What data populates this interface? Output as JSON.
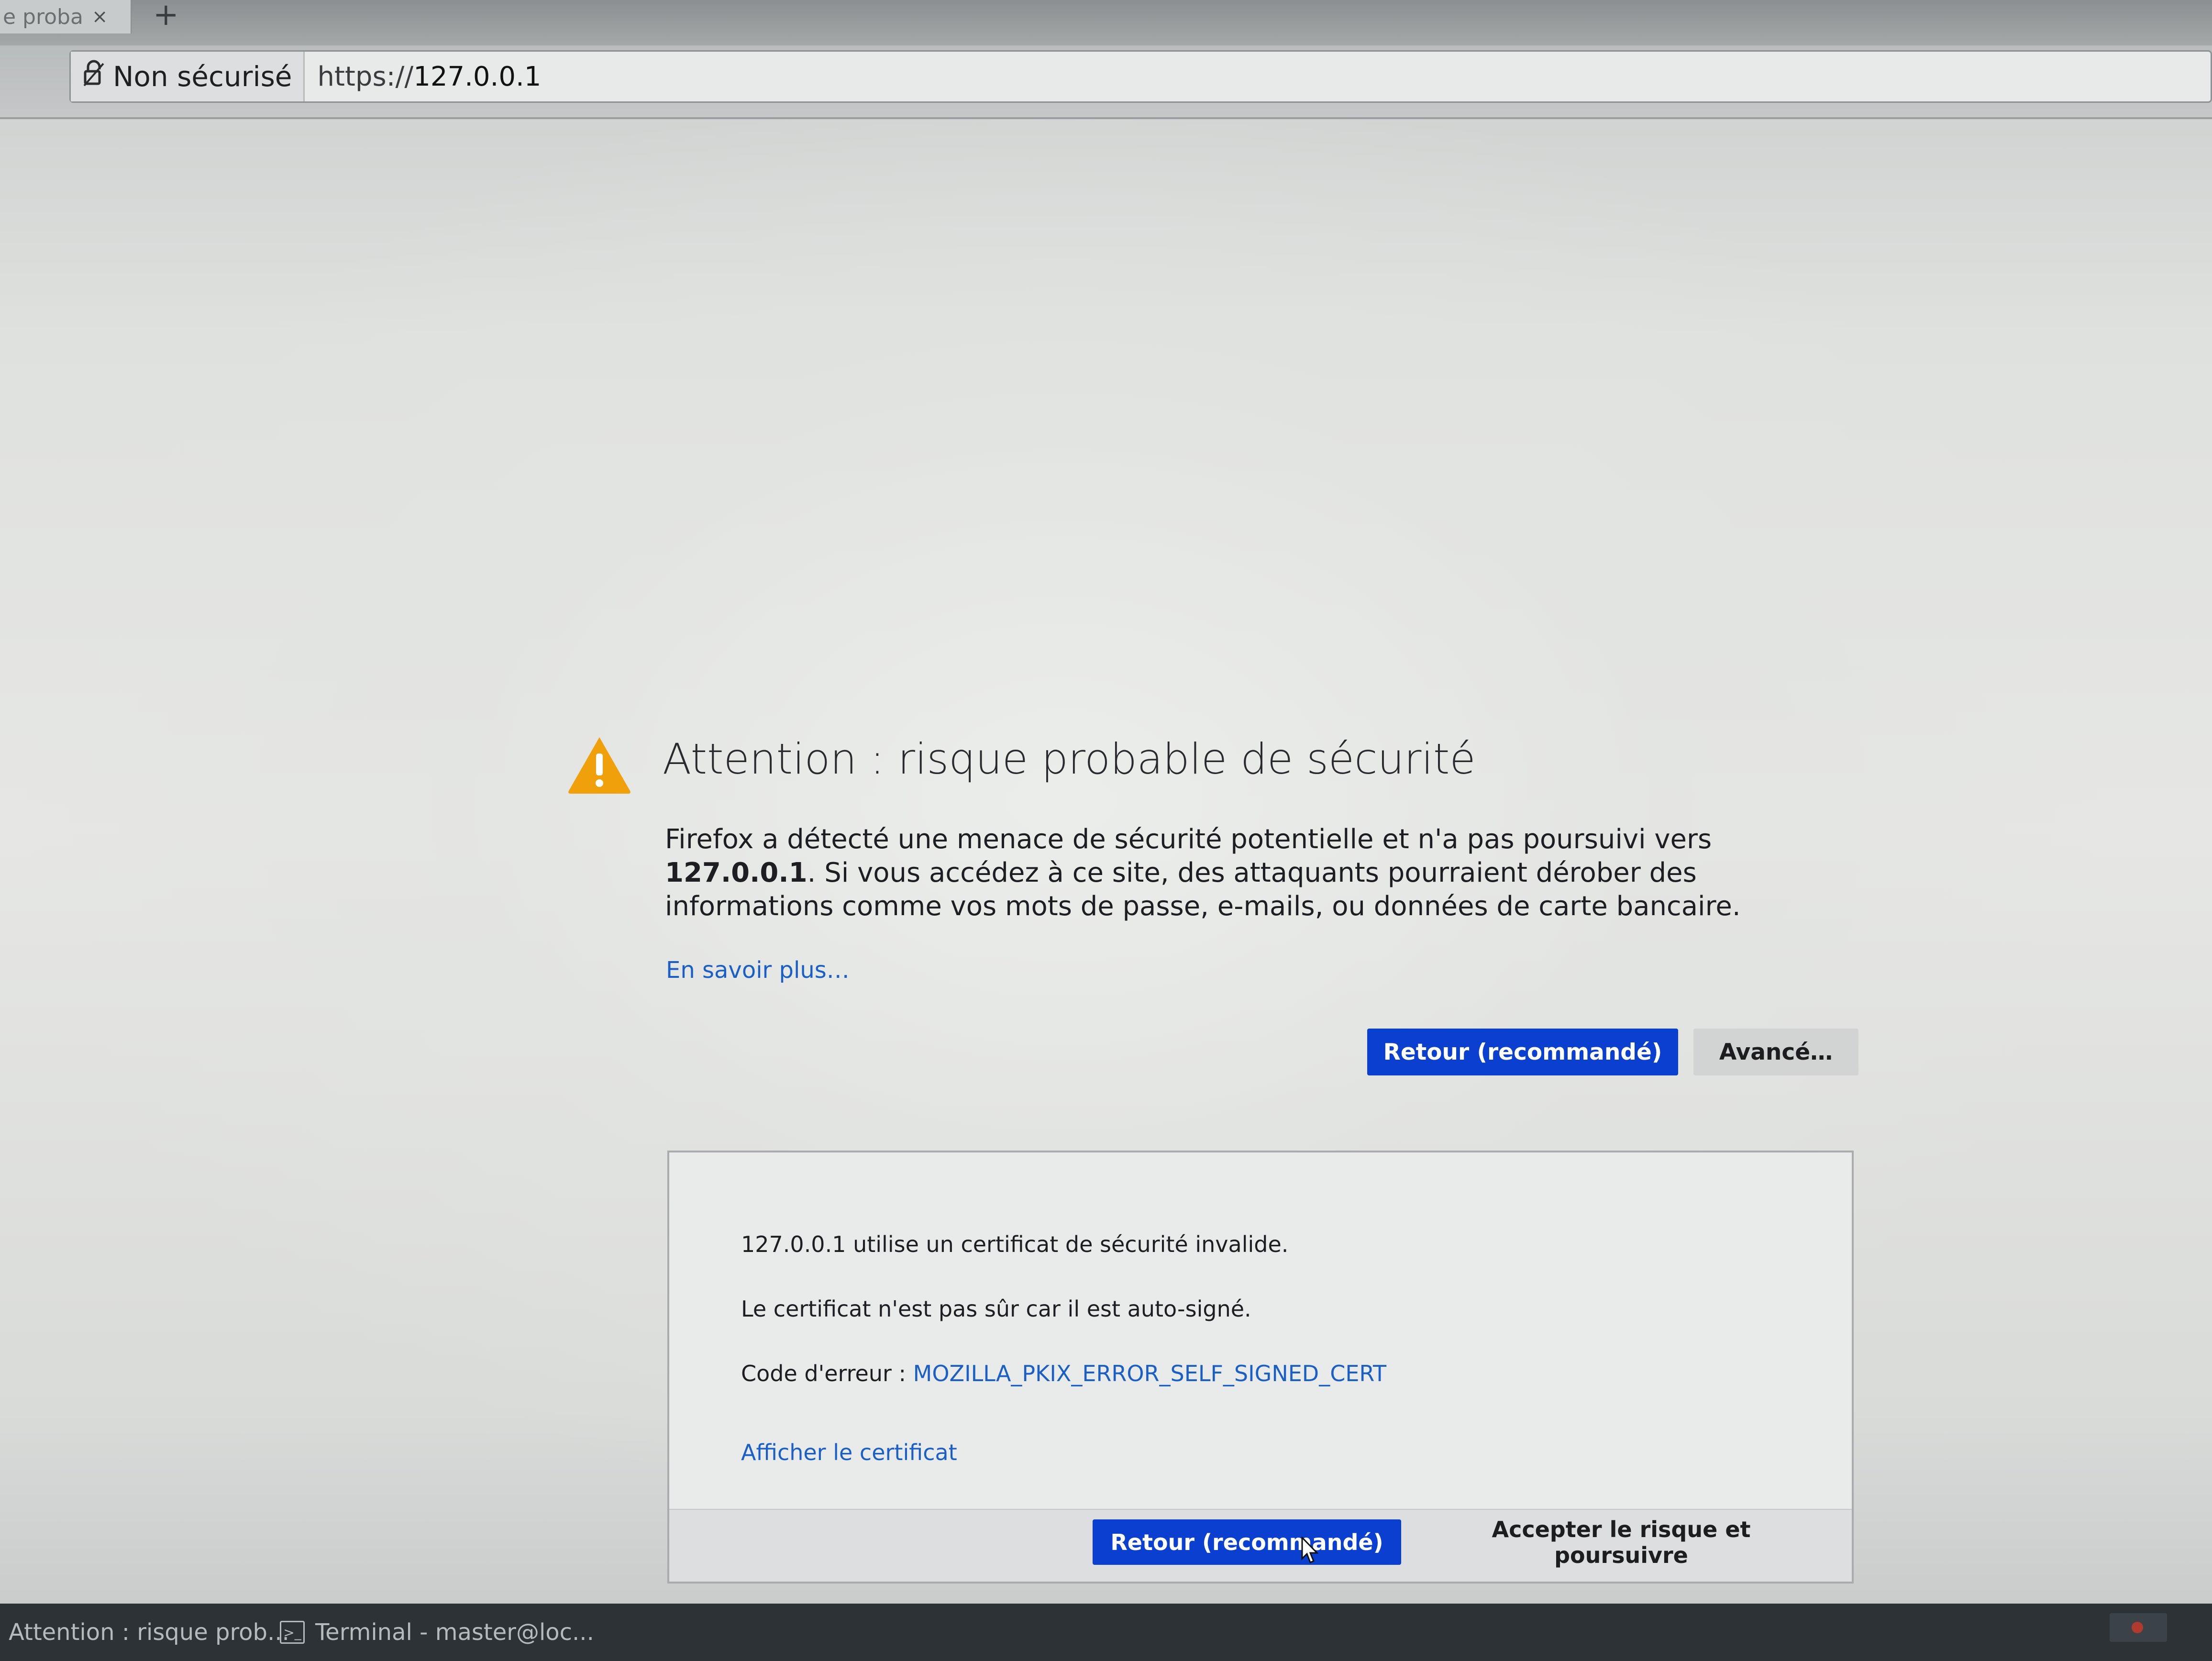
{
  "tabstrip": {
    "active_tab_label": "e proba",
    "tab_close_glyph": "×",
    "new_tab_glyph": "+"
  },
  "urlbar": {
    "identity_label": "Non sécurisé",
    "url_scheme": "https://",
    "url_host": "127.0.0.1"
  },
  "error": {
    "title": "Attention : risque probable de sécurité",
    "desc_part1": "Firefox a détecté une menace de sécurité potentielle et n'a pas poursuivi vers ",
    "desc_host": "127.0.0.1",
    "desc_part2": ". Si vous accédez à ce site, des attaquants pourraient dérober des informations comme vos mots de passe, e-mails, ou données de carte bancaire.",
    "learn_more_label": "En savoir plus…",
    "go_back_label": "Retour (recommandé)",
    "advanced_label": "Avancé…"
  },
  "advanced": {
    "line1": "127.0.0.1 utilise un certificat de sécurité invalide.",
    "line2": "Le certificat n'est pas sûr car il est auto-signé.",
    "error_code_prefix": "Code d'erreur : ",
    "error_code": "MOZILLA_PKIX_ERROR_SELF_SIGNED_CERT",
    "view_cert_label": "Afficher le certificat",
    "go_back_label": "Retour (recommandé)",
    "accept_label": "Accepter le risque et poursuivre"
  },
  "taskbar": {
    "item1_label": "Attention : risque prob...",
    "item2_label": "Terminal - master@loc...",
    "terminal_icon_glyph": ">_"
  },
  "colors": {
    "primary_button": "#0b3fd0",
    "link": "#1a5fc7",
    "warning_icon": "#f0a00a"
  }
}
